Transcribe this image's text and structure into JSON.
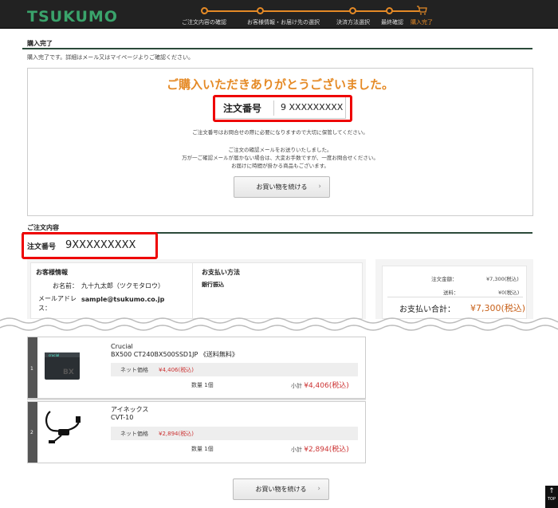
{
  "header": {
    "logo": "TSUKUMO",
    "steps": [
      {
        "label": "ご注文内容の確認"
      },
      {
        "label": "お客様情報・お届け先の選択"
      },
      {
        "label": "決済方法選択"
      },
      {
        "label": "最終確認"
      },
      {
        "label": "購入完了"
      }
    ],
    "accent": "#e58a26"
  },
  "complete": {
    "title": "購入完了",
    "note": "購入完了です。詳細はメール又はマイページよりご確認ください。",
    "thanks": "ご購入いただきありがとうございました。",
    "order_label": "注文番号",
    "order_value": "9 XXXXXXXXX",
    "info1": "ご注文番号はお問合せの際に必要になりますので大切に保管してください。",
    "info2": "ご注文の確認メールをお送りいたしました。",
    "info3": "万が一ご確認メールが届かない場合は、大変お手数ですが、一度お問合せください。",
    "info4": "お届けに時間が掛かる商品もございます。",
    "continue_label": "お買い物を続ける"
  },
  "contents": {
    "title": "ご注文内容",
    "order_label": "注文番号",
    "order_value": "9XXXXXXXXX",
    "customer_title": "お客様情報",
    "name_k": "お名前：",
    "name_v": "九十九太郎（ツクモタロウ）",
    "mail_k": "メールアドレス：",
    "mail_v": "sample@tsukumo.co.jp",
    "payment_title": "お支払い方法",
    "payment_v": "銀行振込",
    "summary": {
      "amount_k": "注文金額：",
      "amount_v": "¥7,300(税込)",
      "ship_k": "送料：",
      "ship_v": "¥0(税込)",
      "total_k": "お支払い合計：",
      "total_v": "¥7,300(税込)"
    }
  },
  "items": [
    {
      "num": "1",
      "maker": "Crucial",
      "name": "BX500 CT240BX500SSD1JP 《送料無料》",
      "price_k": "ネット価格",
      "price_v": "¥4,406(税込)",
      "qty": "数量 1個",
      "subtotal_k": "小計",
      "subtotal_v": "¥4,406(税込)"
    },
    {
      "num": "2",
      "maker": "アイネックス",
      "name": "CVT-10",
      "price_k": "ネット価格",
      "price_v": "¥2,894(税込)",
      "qty": "数量 1個",
      "subtotal_k": "小計",
      "subtotal_v": "¥2,894(税込)"
    }
  ],
  "footer": {
    "continue_label": "お買い物を続ける",
    "top_label": "TOP"
  }
}
